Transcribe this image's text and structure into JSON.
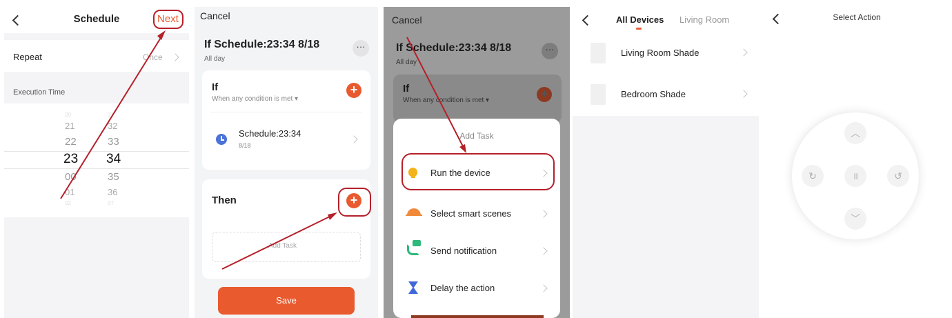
{
  "panel1": {
    "title": "Schedule",
    "next_label": "Next",
    "repeat_label": "Repeat",
    "repeat_value": "Once",
    "execution_time_label": "Execution Time",
    "hours": [
      "21",
      "22",
      "23",
      "00",
      "01"
    ],
    "minutes": [
      "32",
      "33",
      "34",
      "35",
      "36"
    ]
  },
  "panel2": {
    "cancel_label": "Cancel",
    "title": "If Schedule:23:34 8/18",
    "subtitle": "All day",
    "more_label": "···",
    "if_label": "If",
    "condition_mode": "When any condition is met",
    "condition_name": "Schedule:23:34",
    "condition_date": "8/18",
    "then_label": "Then",
    "add_task_label": "Add Task",
    "save_label": "Save"
  },
  "panel3": {
    "cancel_label": "Cancel",
    "title": "If Schedule:23:34 8/18",
    "subtitle": "All day",
    "if_label": "If",
    "condition_mode": "When any condition is met",
    "sheet_title": "Add Task",
    "options": [
      {
        "label": "Run the device",
        "icon": "bulb-icon"
      },
      {
        "label": "Select smart scenes",
        "icon": "sunrise-icon"
      },
      {
        "label": "Send notification",
        "icon": "phone-message-icon"
      },
      {
        "label": "Delay the action",
        "icon": "hourglass-icon"
      }
    ]
  },
  "panel4": {
    "tabs": [
      "All Devices",
      "Living Room"
    ],
    "devices": [
      "Living Room Shade",
      "Bedroom Shade"
    ]
  },
  "panel5": {
    "title": "Select Action"
  },
  "colors": {
    "accent": "#e95a2e",
    "annotation": "#b5202a"
  }
}
